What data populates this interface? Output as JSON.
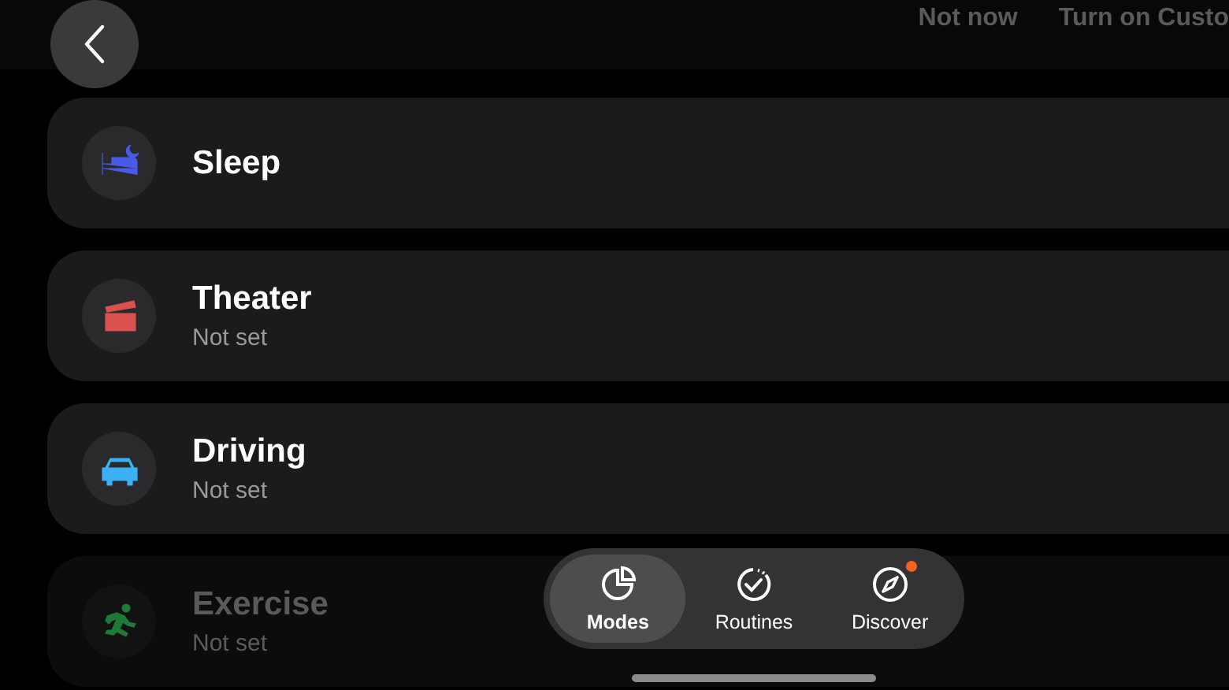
{
  "top_actions": [
    "Not now",
    "Turn on Custo"
  ],
  "modes": [
    {
      "title": "Sleep",
      "kind": "bed",
      "color": "#4a5ae8",
      "faded": false
    },
    {
      "title": "Theater",
      "subtitle": "Not set",
      "kind": "clapper",
      "color": "#d9524f",
      "faded": false
    },
    {
      "title": "Driving",
      "subtitle": "Not set",
      "kind": "car",
      "color": "#3bb0f5",
      "faded": false
    },
    {
      "title": "Exercise",
      "subtitle": "Not set",
      "kind": "runner",
      "color": "#1f7a3a",
      "faded": true
    }
  ],
  "nav": [
    {
      "label": "Modes",
      "kind": "pie",
      "selected": true,
      "badge": false
    },
    {
      "label": "Routines",
      "kind": "check",
      "selected": false,
      "badge": false
    },
    {
      "label": "Discover",
      "kind": "compass",
      "selected": false,
      "badge": true
    }
  ]
}
